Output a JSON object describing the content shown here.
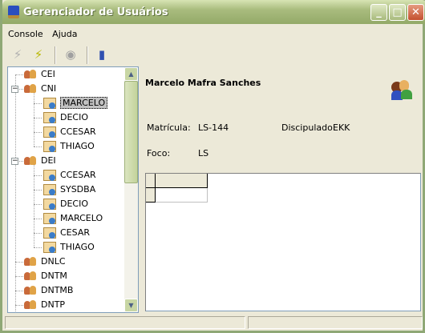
{
  "window": {
    "title": "Gerenciador de Usuários",
    "minimize": "_",
    "maximize": "□",
    "close": "✕"
  },
  "menu": [
    "Console",
    "Ajuda"
  ],
  "toolbar": {
    "icons": [
      "disconnect-icon",
      "connect-icon",
      "clock-icon",
      "exit-door-icon"
    ]
  },
  "tree": [
    {
      "label": "CEI",
      "type": "group",
      "level": 0
    },
    {
      "label": "CNI",
      "type": "group",
      "level": 0,
      "expanded": true
    },
    {
      "label": "MARCELO",
      "type": "user",
      "level": 1,
      "selected": true
    },
    {
      "label": "DECIO",
      "type": "user",
      "level": 1
    },
    {
      "label": "CCESAR",
      "type": "user",
      "level": 1
    },
    {
      "label": "THIAGO",
      "type": "user",
      "level": 1
    },
    {
      "label": "DEI",
      "type": "group",
      "level": 0,
      "expanded": true
    },
    {
      "label": "CCESAR",
      "type": "user",
      "level": 1
    },
    {
      "label": "SYSDBA",
      "type": "user",
      "level": 1
    },
    {
      "label": "DECIO",
      "type": "user",
      "level": 1
    },
    {
      "label": "MARCELO",
      "type": "user",
      "level": 1
    },
    {
      "label": "CESAR",
      "type": "user",
      "level": 1
    },
    {
      "label": "THIAGO",
      "type": "user",
      "level": 1
    },
    {
      "label": "DNLC",
      "type": "group",
      "level": 0
    },
    {
      "label": "DNTM",
      "type": "group",
      "level": 0
    },
    {
      "label": "DNTMB",
      "type": "group",
      "level": 0
    },
    {
      "label": "DNTP",
      "type": "group",
      "level": 0
    }
  ],
  "detail": {
    "name": "Marcelo Mafra Sanches",
    "matricula_label": "Matrícula:",
    "matricula": "LS-144",
    "discipulado_label": "Discipulado:",
    "discipulado": "EKK",
    "foco_label": "Foco:",
    "foco": "LS"
  }
}
